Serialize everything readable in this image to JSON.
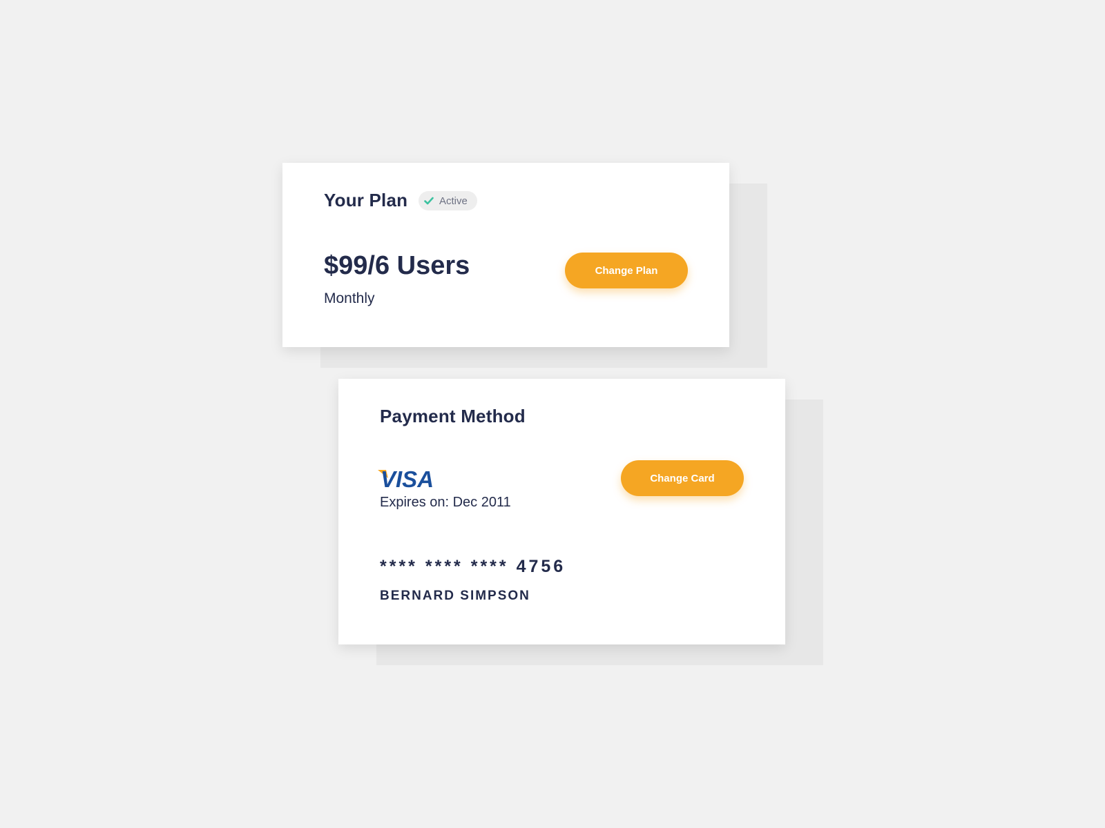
{
  "plan": {
    "title": "Your Plan",
    "status_label": "Active",
    "price": "$99/6 Users",
    "period": "Monthly",
    "change_button_label": "Change Plan"
  },
  "payment": {
    "title": "Payment Method",
    "card_brand": "VISA",
    "expires": "Expires on: Dec 2011",
    "card_number": "**** **** **** 4756",
    "cardholder": "BERNARD SIMPSON",
    "change_button_label": "Change Card"
  },
  "colors": {
    "background": "#f1f1f1",
    "card": "#ffffff",
    "text": "#232b4b",
    "accent": "#f5a623",
    "status_check": "#3cc2a0",
    "visa_blue": "#1a4f9c",
    "visa_gold": "#f7a823"
  },
  "icons": {
    "status": "check-icon",
    "card_brand": "visa-logo"
  }
}
